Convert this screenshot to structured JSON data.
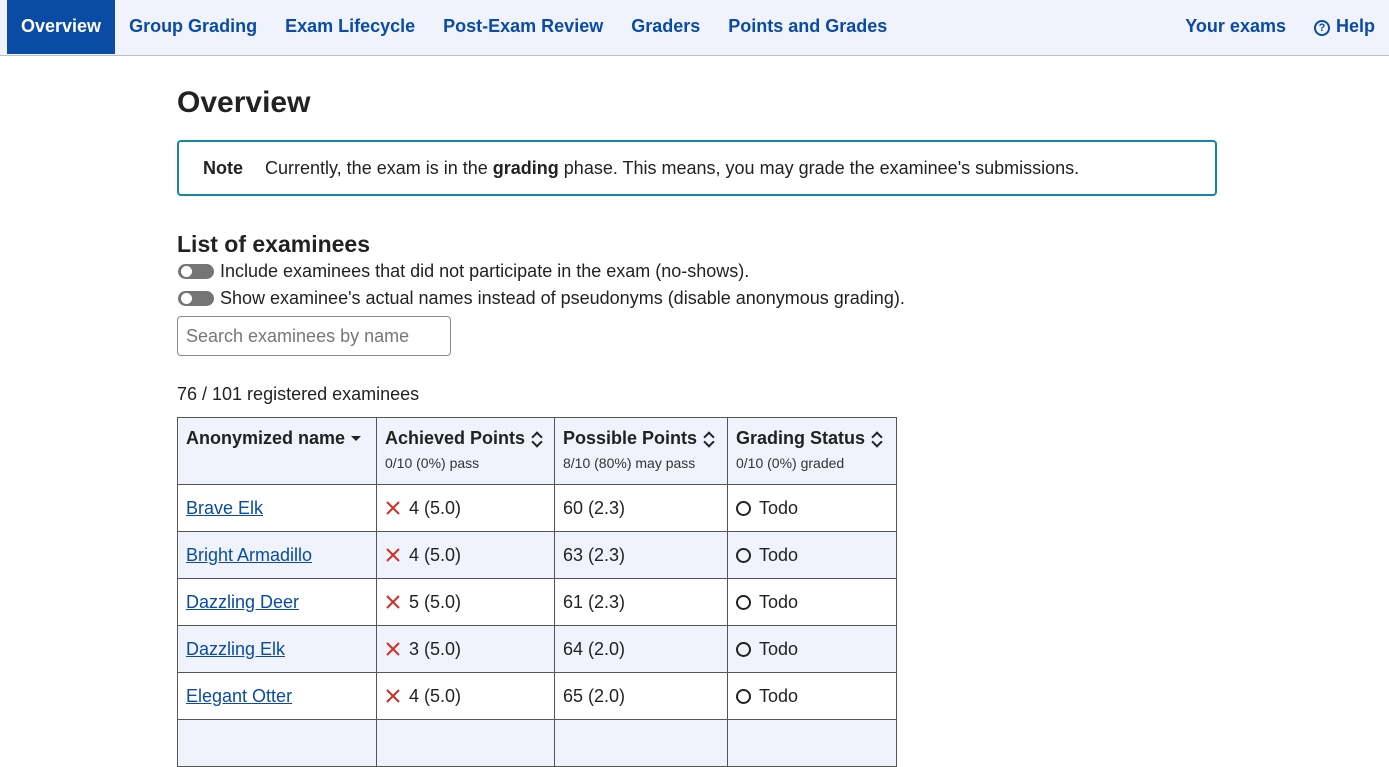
{
  "nav": {
    "items": [
      {
        "label": "Overview",
        "active": true
      },
      {
        "label": "Group Grading"
      },
      {
        "label": "Exam Lifecycle"
      },
      {
        "label": "Post-Exam Review"
      },
      {
        "label": "Graders"
      },
      {
        "label": "Points and Grades"
      }
    ],
    "your_exams": "Your exams",
    "help": "Help"
  },
  "page": {
    "title": "Overview",
    "note": {
      "label": "Note",
      "text_before": "Currently, the exam is in the",
      "text_bold": "grading",
      "text_after": "phase. This means, you may grade the examinee's submissions."
    },
    "list_title": "List of examinees",
    "toggle_noshows": "Include examinees that did not participate in the exam (no-shows).",
    "toggle_names": "Show examinee's actual names instead of pseudonyms (disable anonymous grading).",
    "search_placeholder": "Search examinees by name",
    "count": "76 / 101 registered examinees"
  },
  "table": {
    "headers": [
      {
        "label": "Anonymized name",
        "sub": ""
      },
      {
        "label": "Achieved Points",
        "sub": "0/10 (0%) pass"
      },
      {
        "label": "Possible Points",
        "sub": "8/10 (80%) may pass"
      },
      {
        "label": "Grading Status",
        "sub": "0/10 (0%) graded"
      }
    ],
    "rows": [
      {
        "name": "Brave Elk",
        "achieved": "4 (5.0)",
        "possible": "60 (2.3)",
        "status": "Todo"
      },
      {
        "name": "Bright Armadillo",
        "achieved": "4 (5.0)",
        "possible": "63 (2.3)",
        "status": "Todo"
      },
      {
        "name": "Dazzling Deer",
        "achieved": "5 (5.0)",
        "possible": "61 (2.3)",
        "status": "Todo"
      },
      {
        "name": "Dazzling Elk",
        "achieved": "3 (5.0)",
        "possible": "64 (2.0)",
        "status": "Todo"
      },
      {
        "name": "Elegant Otter",
        "achieved": "4 (5.0)",
        "possible": "65 (2.0)",
        "status": "Todo"
      }
    ]
  },
  "colors": {
    "primary": "#0a4ba5",
    "fail": "#d22f27",
    "note_border": "#1a83a8"
  }
}
